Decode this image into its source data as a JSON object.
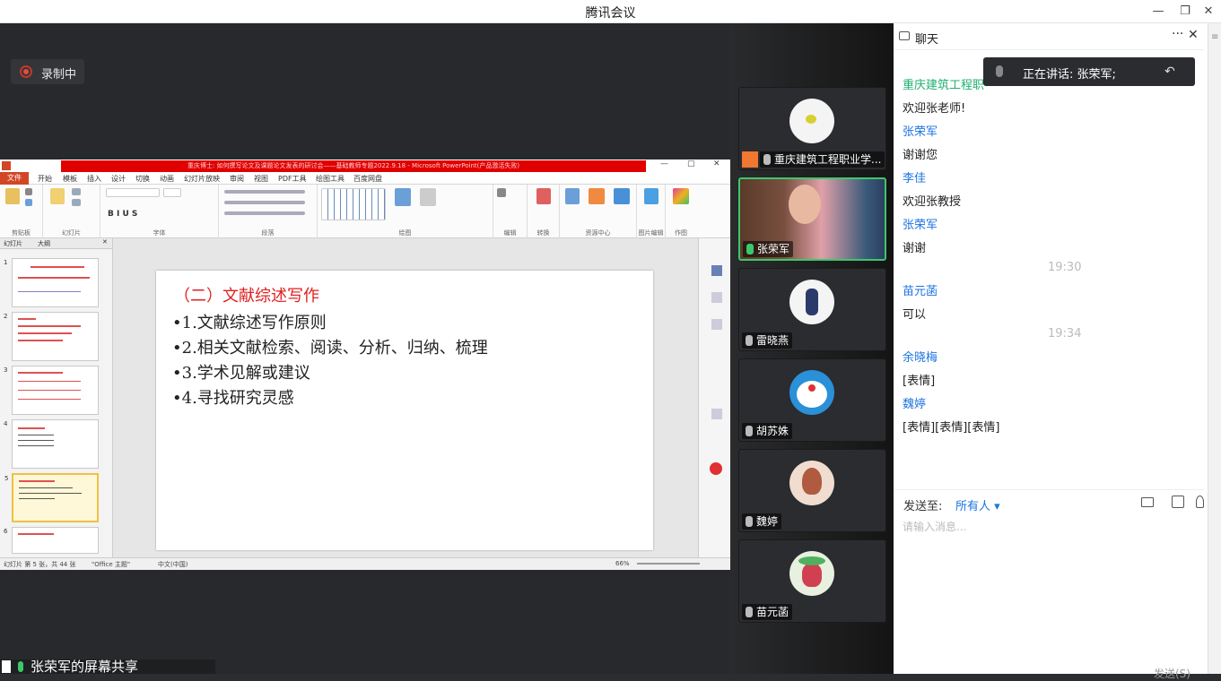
{
  "window": {
    "title": "腾讯会议"
  },
  "recording": {
    "label": "录制中"
  },
  "ppt": {
    "title_bar": "重庆博士: 如何撰写论文及课题论文发表的研讨会——基础教师专题2022.9.18 - Microsoft PowerPoint(产品激活失败)",
    "tabs": [
      "开始",
      "模板",
      "插入",
      "设计",
      "切换",
      "动画",
      "幻灯片放映",
      "审阅",
      "视图",
      "PDF工具",
      "绘图工具",
      "百度网盘"
    ],
    "file_tab": "文件",
    "ribbon_groups": [
      "剪贴板",
      "幻灯片",
      "字体",
      "段落",
      "绘图",
      "编辑",
      "转换",
      "资源中心",
      "图片编辑",
      "作图"
    ],
    "thumb_tabs": [
      "幻灯片",
      "大纲"
    ],
    "slide": {
      "title": "（二）文献综述写作",
      "bullets": [
        "•1.文献综述写作原则",
        "•2.相关文献检索、阅读、分析、归纳、梳理",
        "•3.学术见解或建议",
        "•4.寻找研究灵感"
      ]
    },
    "status": {
      "slide_info": "幻灯片 第 5 张，共 44 张",
      "theme": "\"Office 主题\"",
      "lang": "中文(中国)",
      "zoom": "66%"
    }
  },
  "share_label": "张荣军的屏幕共享",
  "participants": [
    {
      "name": "重庆建筑工程职业学...",
      "mic": "muted"
    },
    {
      "name": "张荣军",
      "mic": "active"
    },
    {
      "name": "雷晓燕",
      "mic": "muted"
    },
    {
      "name": "胡苏姝",
      "mic": "muted"
    },
    {
      "name": "魏婷",
      "mic": "muted"
    },
    {
      "name": "苗元菡",
      "mic": "muted"
    }
  ],
  "chat": {
    "title": "聊天",
    "speaking": "正在讲话: 张荣军;",
    "messages": [
      {
        "kind": "name",
        "text": "重庆建筑工程职",
        "color": "#20b070"
      },
      {
        "kind": "text",
        "text": "欢迎张老师!"
      },
      {
        "kind": "name",
        "text": "张荣军"
      },
      {
        "kind": "text",
        "text": "谢谢您"
      },
      {
        "kind": "name",
        "text": "李佳"
      },
      {
        "kind": "text",
        "text": "欢迎张教授"
      },
      {
        "kind": "name",
        "text": "张荣军"
      },
      {
        "kind": "text",
        "text": "谢谢"
      },
      {
        "kind": "time",
        "text": "19:30"
      },
      {
        "kind": "name",
        "text": "苗元菡"
      },
      {
        "kind": "text",
        "text": "可以"
      },
      {
        "kind": "time",
        "text": "19:34"
      },
      {
        "kind": "name",
        "text": "余晓梅"
      },
      {
        "kind": "text",
        "text": "[表情]"
      },
      {
        "kind": "name",
        "text": "魏婷"
      },
      {
        "kind": "text",
        "text": "[表情][表情][表情]"
      }
    ],
    "send_to_label": "发送至:",
    "send_to_value": "所有人",
    "input_placeholder": "请输入消息...",
    "send_button": "发送(S)"
  }
}
